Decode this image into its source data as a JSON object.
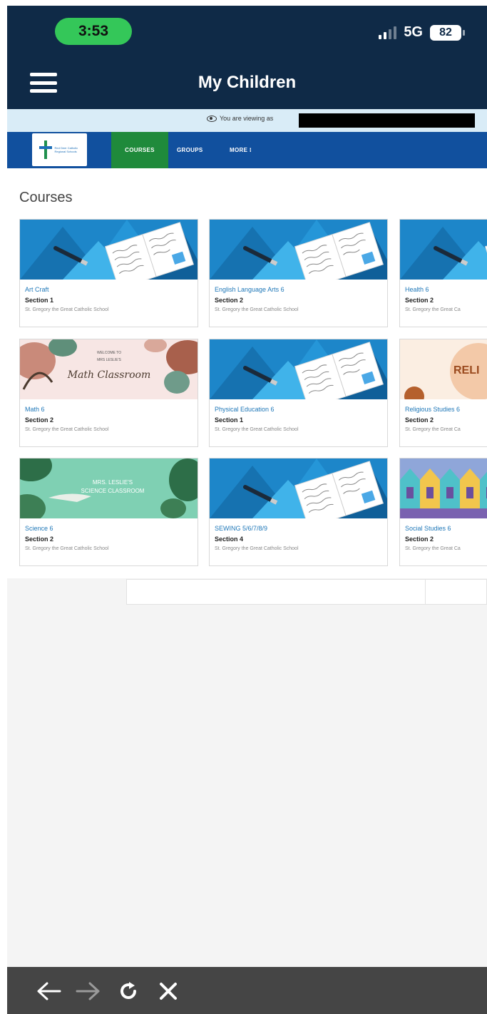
{
  "status_bar": {
    "time": "3:53",
    "network": "5G",
    "battery": "82"
  },
  "app_header": {
    "title": "My Children"
  },
  "viewing_banner": {
    "text": "You are viewing as"
  },
  "lms_nav": {
    "logo_text": "Red Deer Catholic Regional Schools",
    "items": [
      "COURSES",
      "GROUPS",
      "MORE ⁝"
    ]
  },
  "courses": {
    "heading": "Courses",
    "cards": [
      {
        "name": "Art Craft",
        "section": "Section 1",
        "school": "St. Gregory the Great Catholic School",
        "banner": "book"
      },
      {
        "name": "English Language Arts 6",
        "section": "Section 2",
        "school": "St. Gregory the Great Catholic School",
        "banner": "book"
      },
      {
        "name": "Health 6",
        "section": "Section 2",
        "school": "St. Gregory the Great Ca",
        "banner": "book"
      },
      {
        "name": "Math 6",
        "section": "Section 2",
        "school": "St. Gregory the Great Catholic School",
        "banner": "math",
        "banner_text_top": "WELCOME TO",
        "banner_text_mid": "MRS LESLIE'S",
        "banner_text_main": "Math Classroom"
      },
      {
        "name": "Physical Education 6",
        "section": "Section 1",
        "school": "St. Gregory the Great Catholic School",
        "banner": "book"
      },
      {
        "name": "Religious Studies 6",
        "section": "Section 2",
        "school": "St. Gregory the Great Ca",
        "banner": "religion",
        "banner_text_main": "RELI"
      },
      {
        "name": "Science 6",
        "section": "Section 2",
        "school": "St. Gregory the Great Catholic School",
        "banner": "science",
        "banner_text_top": "MRS. LESLIE'S",
        "banner_text_main": "SCIENCE CLASSROOM"
      },
      {
        "name": "SEWING 5/6/7/8/9",
        "section": "Section 4",
        "school": "St. Gregory the Great Catholic School",
        "banner": "book"
      },
      {
        "name": "Social Studies 6",
        "section": "Section 2",
        "school": "St. Gregory the Great Ca",
        "banner": "houses"
      }
    ]
  },
  "colors": {
    "header_bg": "#0f2a47",
    "lms_nav_bg": "#11509e",
    "active_tab": "#1f8a3b",
    "link": "#1e77b8",
    "time_pill": "#34c759",
    "browser_bar": "#454545"
  },
  "browser_toolbar": {
    "icons": [
      "back-arrow-icon",
      "forward-arrow-icon",
      "reload-icon",
      "close-icon"
    ]
  }
}
